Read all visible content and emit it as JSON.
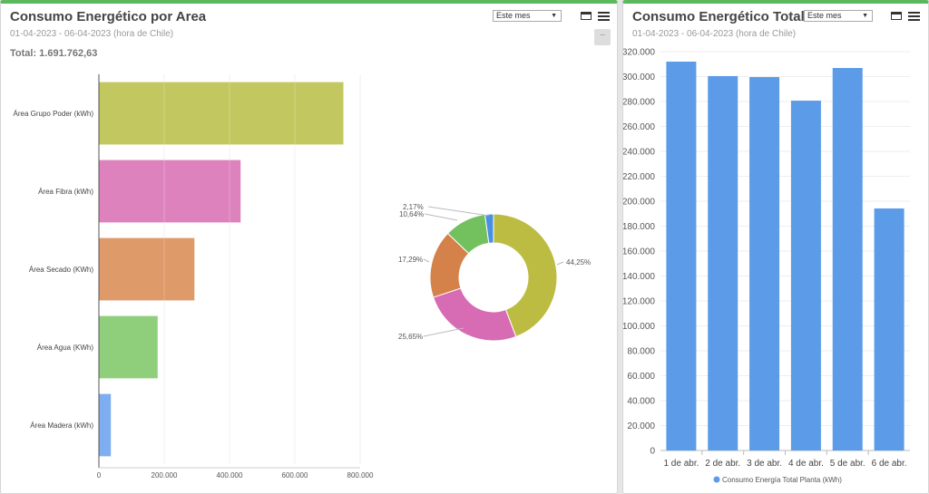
{
  "left_panel": {
    "title": "Consumo Energético por Area",
    "date_range": "01-04-2023 - 06-04-2023 (hora de Chile)",
    "total": "Total: 1.691.762,63",
    "period_select": "Este mes",
    "minimize_label": "–",
    "chart_data": [
      {
        "type": "bar",
        "orientation": "horizontal",
        "categories": [
          "Área Grupo Poder (kWh)",
          "Área Fibra (kWh)",
          "Área Secado (KWh)",
          "Área Agua (KWh)",
          "Área Madera (kWh)"
        ],
        "values": [
          748600,
          433900,
          292500,
          180000,
          36700
        ],
        "colors": [
          "#c3c75f",
          "#dd82bd",
          "#df9a6a",
          "#8fcf7b",
          "#7eaef0"
        ],
        "xlim": [
          0,
          800000
        ],
        "x_ticks": [
          "0",
          "200.000",
          "400.000",
          "600.000",
          "800.000"
        ],
        "grid": true
      },
      {
        "type": "pie",
        "donut": true,
        "labels": [
          "44,25%",
          "25,65%",
          "17,29%",
          "10,64%",
          "2,17%"
        ],
        "values": [
          44.25,
          25.65,
          17.29,
          10.64,
          2.17
        ],
        "colors": [
          "#bcbc42",
          "#d76bb4",
          "#d4814a",
          "#72c05e",
          "#4a90e2"
        ]
      }
    ]
  },
  "right_panel": {
    "title": "Consumo Energético Total",
    "date_range": "01-04-2023 - 06-04-2023 (hora de Chile)",
    "period_select": "Este mes",
    "chart_data": {
      "type": "bar",
      "categories": [
        "1 de abr.",
        "2 de abr.",
        "3 de abr.",
        "4 de abr.",
        "5 de abr.",
        "6 de abr."
      ],
      "series": [
        {
          "name": "Consumo Energía Total Planta (kWh)",
          "values": [
            312000,
            300400,
            299600,
            280700,
            306900,
            194200
          ]
        }
      ],
      "color": "#5b9be8",
      "ylim": [
        0,
        320000
      ],
      "y_ticks": [
        "0",
        "20.000",
        "40.000",
        "60.000",
        "80.000",
        "100.000",
        "120.000",
        "140.000",
        "160.000",
        "180.000",
        "200.000",
        "220.000",
        "240.000",
        "260.000",
        "280.000",
        "300.000",
        "320.000"
      ],
      "legend": "bottom",
      "grid": true
    }
  }
}
